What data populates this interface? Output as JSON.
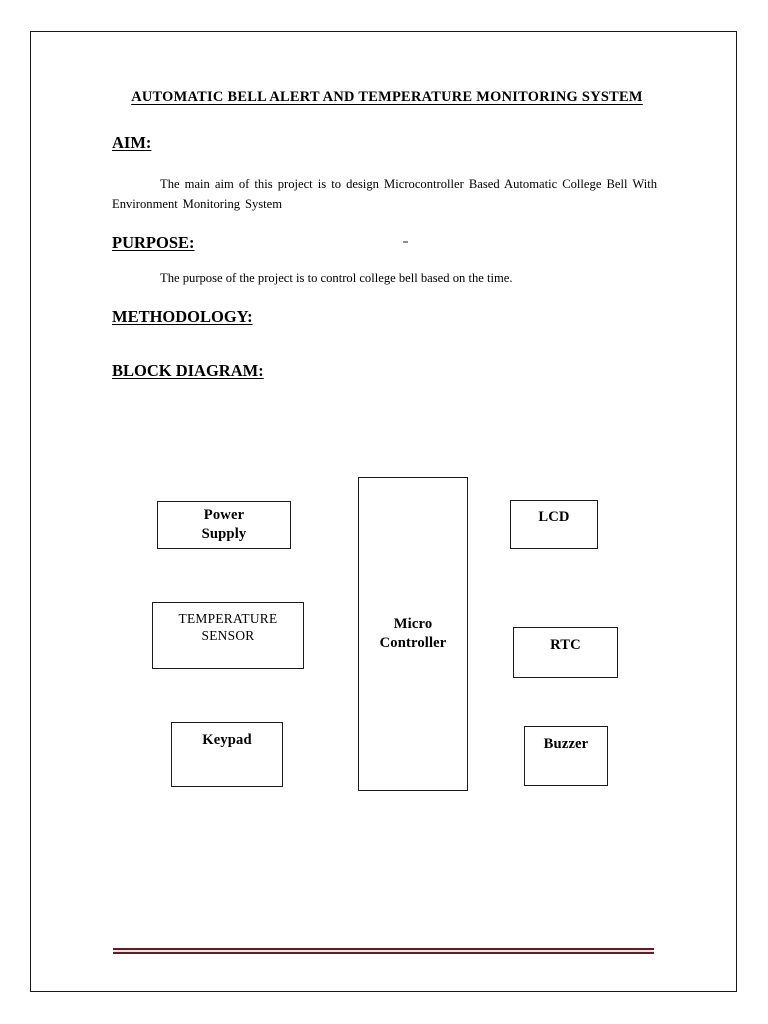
{
  "document": {
    "title": "AUTOMATIC BELL ALERT AND TEMPERATURE MONITORING SYSTEM",
    "sections": {
      "aim": {
        "heading": "AIM:",
        "paragraph": "The main aim of this project is to design Microcontroller  Based  Automatic College  Bell With Environment Monitoring System"
      },
      "purpose": {
        "heading": "PURPOSE:",
        "paragraph": "The purpose of the project is to control college bell based on the time."
      },
      "methodology": {
        "heading": "METHODOLOGY:",
        "paragraph": ""
      },
      "block_diagram": {
        "heading": "BLOCK DIAGRAM:"
      }
    }
  },
  "block_diagram": {
    "blocks": [
      {
        "id": "power-supply",
        "label": "Power\nSupply",
        "line1": "Power",
        "line2": "Supply",
        "style": "bold"
      },
      {
        "id": "temperature-sensor",
        "label": "TEMPERATURE SENSOR",
        "line1": "TEMPERATURE",
        "line2": "SENSOR",
        "style": "plain"
      },
      {
        "id": "keypad",
        "label": "Keypad",
        "line1": "Keypad",
        "line2": "",
        "style": "bold"
      },
      {
        "id": "microcontroller",
        "label": "Micro Controller",
        "line1": "Micro",
        "line2": "Controller",
        "style": "bold"
      },
      {
        "id": "lcd",
        "label": "LCD",
        "line1": "LCD",
        "line2": "",
        "style": "bold"
      },
      {
        "id": "rtc",
        "label": "RTC",
        "line1": "RTC",
        "line2": "",
        "style": "bold"
      },
      {
        "id": "buzzer",
        "label": "Buzzer",
        "line1": "Buzzer",
        "line2": "",
        "style": "bold"
      }
    ]
  },
  "colors": {
    "page_border": "#1a1a1a",
    "text": "#000000",
    "box_border": "#1c1c1c",
    "bottom_rule": "#5e2020",
    "bottom_rule_inner": "#efe3e3",
    "page_background": "#ffffff"
  }
}
